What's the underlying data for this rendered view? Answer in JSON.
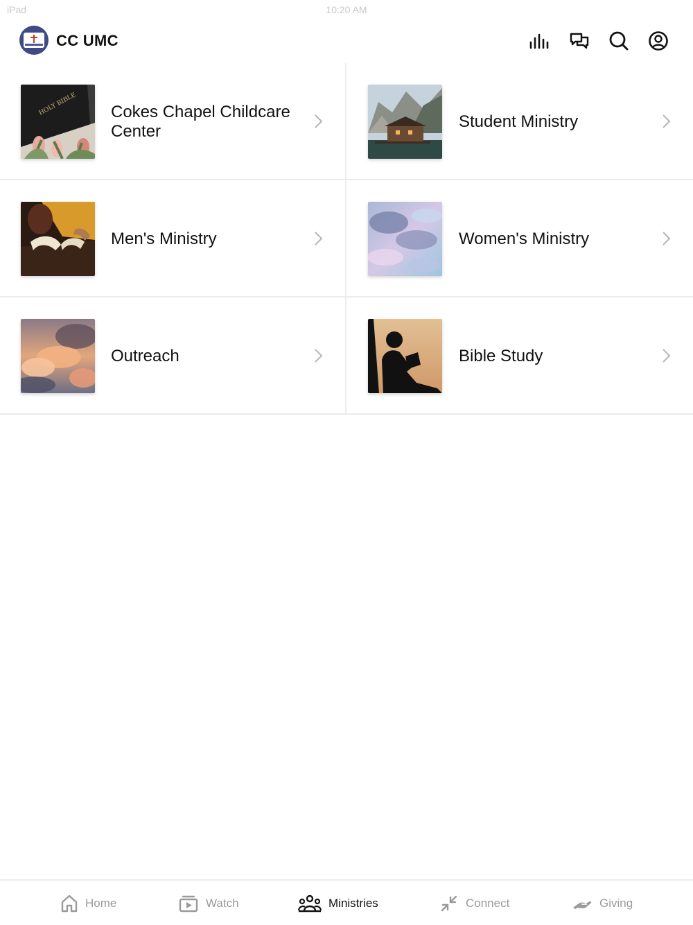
{
  "status_bar": {
    "carrier": "iPad",
    "time": "10:20 AM"
  },
  "header": {
    "title": "CC UMC"
  },
  "ministries": [
    {
      "label": "Cokes Chapel Childcare Center",
      "thumb": "holy-bible-tulips"
    },
    {
      "label": "Student Ministry",
      "thumb": "mountain-lake-cabin"
    },
    {
      "label": "Men's Ministry",
      "thumb": "open-bible-reading"
    },
    {
      "label": "Women's Ministry",
      "thumb": "pastel-clouds"
    },
    {
      "label": "Outreach",
      "thumb": "sunset-clouds"
    },
    {
      "label": "Bible Study",
      "thumb": "silhouette-reader"
    }
  ],
  "tabs": [
    {
      "label": "Home",
      "icon": "home-icon",
      "active": false
    },
    {
      "label": "Watch",
      "icon": "play-box-icon",
      "active": false
    },
    {
      "label": "Ministries",
      "icon": "people-icon",
      "active": true
    },
    {
      "label": "Connect",
      "icon": "arrows-in-icon",
      "active": false
    },
    {
      "label": "Giving",
      "icon": "giving-hand-icon",
      "active": false
    }
  ],
  "colors": {
    "active_tab": "#111111",
    "inactive_tab": "#9a9a9a",
    "divider": "#ececec",
    "logo": "#3f4a86"
  }
}
